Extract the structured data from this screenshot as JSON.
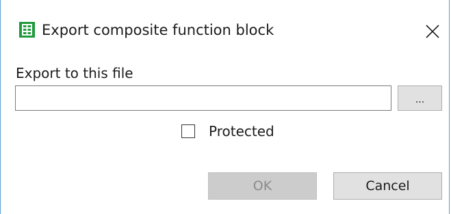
{
  "dialog": {
    "title": "Export composite function block",
    "icon": "spreadsheet-icon",
    "accent_color": "#1e9a3c"
  },
  "export_file": {
    "label": "Export to this file",
    "value": "",
    "placeholder": "",
    "browse_label": "..."
  },
  "protected": {
    "label": "Protected",
    "checked": false
  },
  "buttons": {
    "ok_label": "OK",
    "ok_enabled": false,
    "cancel_label": "Cancel"
  }
}
